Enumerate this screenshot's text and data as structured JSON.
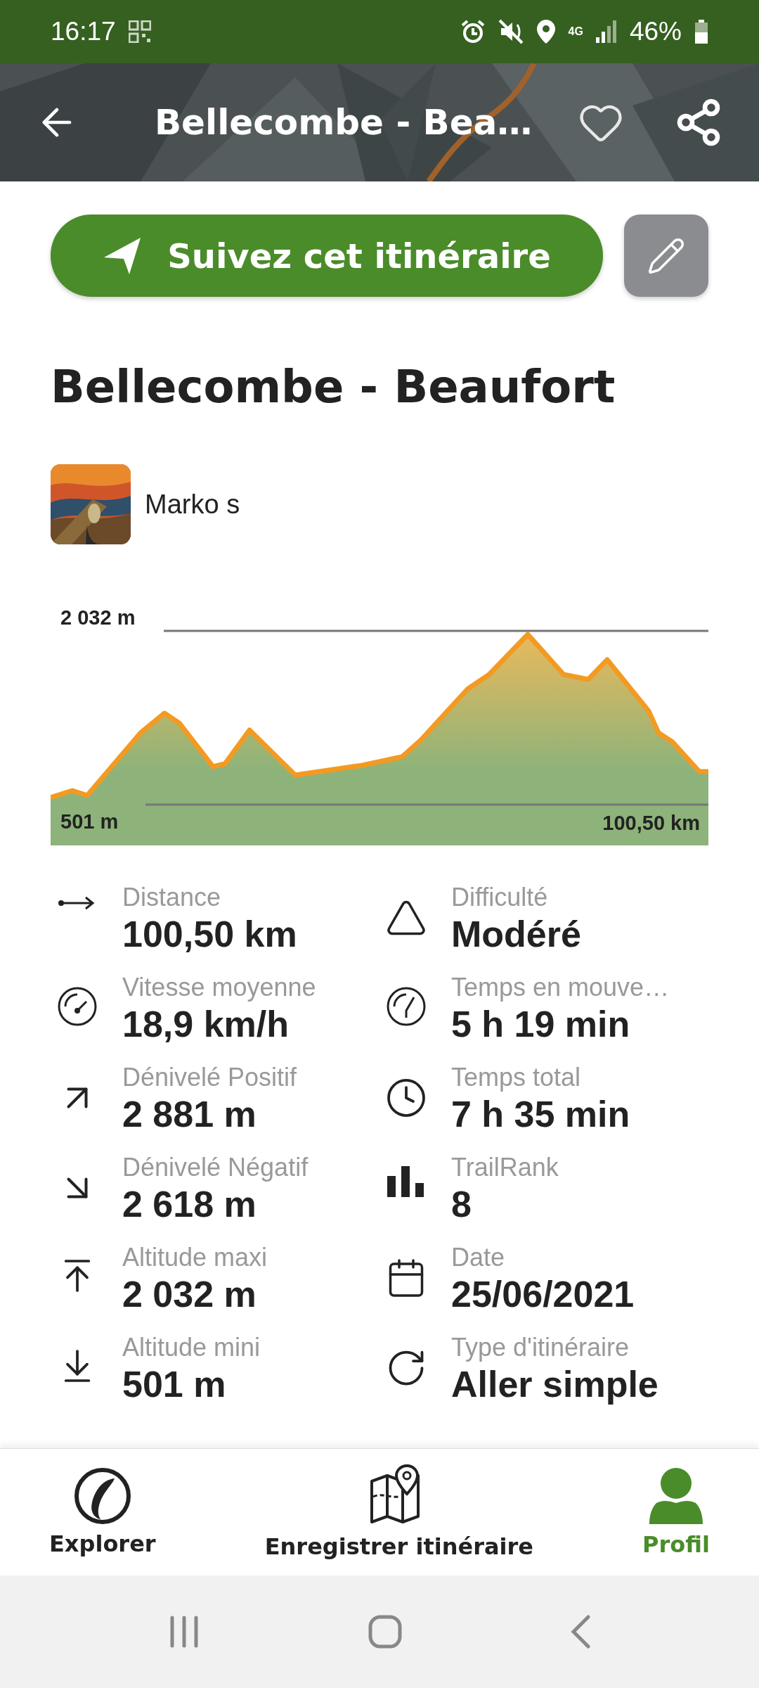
{
  "status_bar": {
    "time": "16:17",
    "network": "4G",
    "battery": "46%"
  },
  "header": {
    "title": "Bellecombe - Bea…"
  },
  "follow_button": {
    "label": "Suivez cet itinéraire"
  },
  "route_title": "Bellecombe - Beaufort",
  "author": {
    "name": "Marko s"
  },
  "elevation_profile": {
    "max_label": "2 032 m",
    "min_label": "501 m",
    "distance_label": "100,50 km"
  },
  "stats": {
    "left": [
      {
        "label": "Distance",
        "value": "100,50 km"
      },
      {
        "label": "Vitesse moyenne",
        "value": "18,9 km/h"
      },
      {
        "label": "Dénivelé Positif",
        "value": "2 881 m"
      },
      {
        "label": "Dénivelé Négatif",
        "value": "2 618 m"
      },
      {
        "label": "Altitude maxi",
        "value": "2 032 m"
      },
      {
        "label": "Altitude mini",
        "value": "501 m"
      }
    ],
    "right": [
      {
        "label": "Difficulté",
        "value": "Modéré"
      },
      {
        "label": "Temps en mouve…",
        "value": "5 h 19 min"
      },
      {
        "label": "Temps total",
        "value": "7 h 35 min"
      },
      {
        "label": "TrailRank",
        "value": "8"
      },
      {
        "label": "Date",
        "value": "25/06/2021"
      },
      {
        "label": "Type d'itinéraire",
        "value": "Aller simple"
      }
    ]
  },
  "bottom_nav": [
    {
      "label": "Explorer",
      "selected": false
    },
    {
      "label": "Enregistrer itinéraire",
      "selected": false
    },
    {
      "label": "Profil",
      "selected": true
    }
  ]
}
